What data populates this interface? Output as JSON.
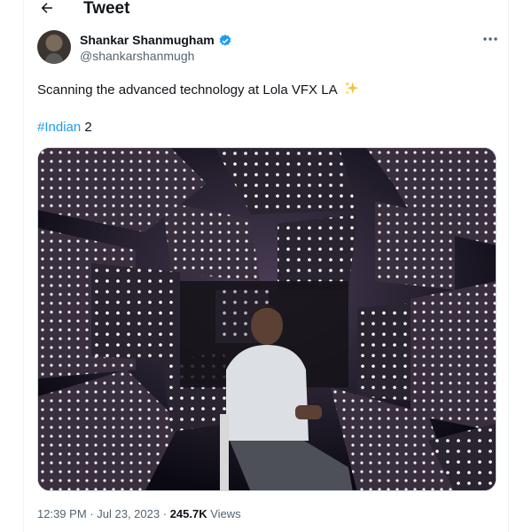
{
  "header": {
    "title": "Tweet",
    "back_icon": "arrow-left-icon"
  },
  "author": {
    "name": "Shankar Shanmugham",
    "handle": "@shankarshanmugh",
    "verified_icon": "verified-badge-icon",
    "verified_color": "#1d9bf0"
  },
  "more_icon": "more-horizontal-icon",
  "tweet": {
    "text": "Scanning the advanced technology at Lola VFX LA",
    "emoji": "sparkles-icon",
    "hashtag": "#Indian",
    "hashtag_suffix": " 2",
    "hashtag_color": "#1d9bf0"
  },
  "media": {
    "alt": "photo"
  },
  "meta": {
    "time": "12:39 PM",
    "separator": "·",
    "date": "Jul 23, 2023",
    "separator2": "·",
    "views_count": "245.7K",
    "views_label": "Views"
  }
}
